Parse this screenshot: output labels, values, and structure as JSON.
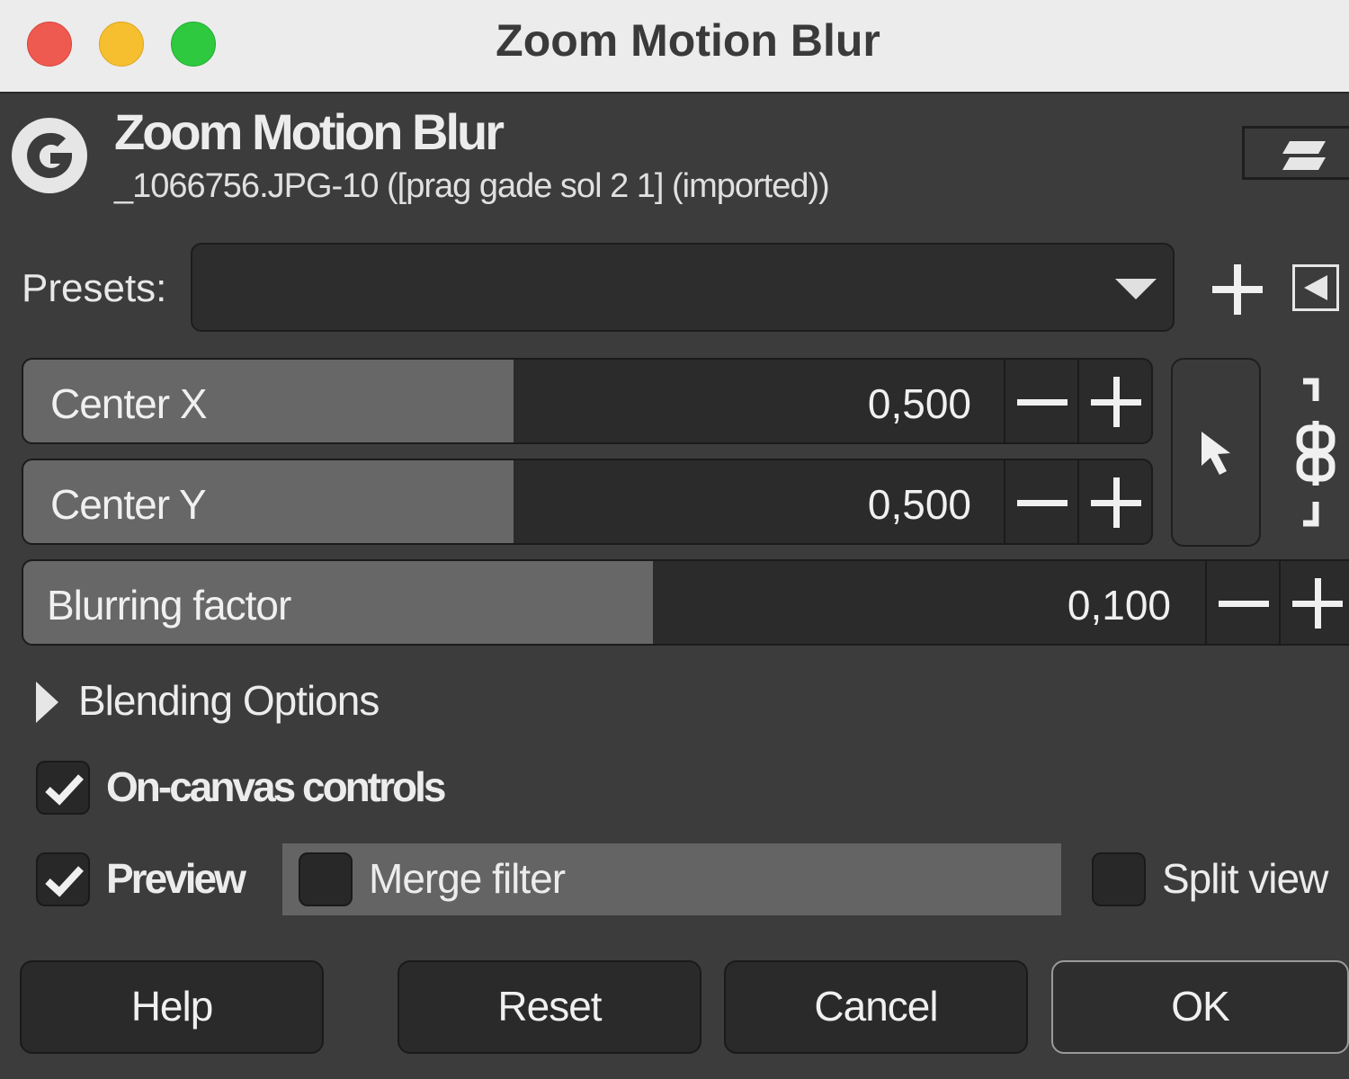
{
  "window": {
    "title": "Zoom Motion Blur",
    "controls": [
      "close",
      "minimize",
      "zoom"
    ]
  },
  "header": {
    "logo_icon": "gimp-logo-icon",
    "title": "Zoom Motion Blur",
    "subtitle": "_1066756.JPG-10 ([prag gade sol 2 1] (imported))",
    "menu_icon": "dialog-menu-icon"
  },
  "presets": {
    "label": "Presets:",
    "value": "",
    "add_icon": "plus-icon",
    "menu_icon": "menu-triangle-icon"
  },
  "params": {
    "center_x": {
      "label": "Center X",
      "value": "0,500",
      "level": 0.5
    },
    "center_y": {
      "label": "Center Y",
      "value": "0,500",
      "level": 0.5
    },
    "blur": {
      "label": "Blurring factor",
      "value": "0,100",
      "level": 0.1
    },
    "pick_icon": "pointer-pick-icon",
    "chain_icon": "chain-link-icon"
  },
  "blending": {
    "label": "Blending Options",
    "expanded": false
  },
  "on_canvas": {
    "label": "On-canvas controls",
    "checked": true
  },
  "preview": {
    "label": "Preview",
    "checked": true
  },
  "merge_filter": {
    "label": "Merge filter",
    "checked": false
  },
  "split_view": {
    "label": "Split view",
    "checked": false
  },
  "buttons": {
    "help": "Help",
    "reset": "Reset",
    "cancel": "Cancel",
    "ok": "OK"
  },
  "colors": {
    "window_bg": "#3c3c3c",
    "titlebar_bg": "#ececec",
    "close": "#ee5a50",
    "minimize": "#f5bf2f",
    "zoom": "#2fc940"
  }
}
